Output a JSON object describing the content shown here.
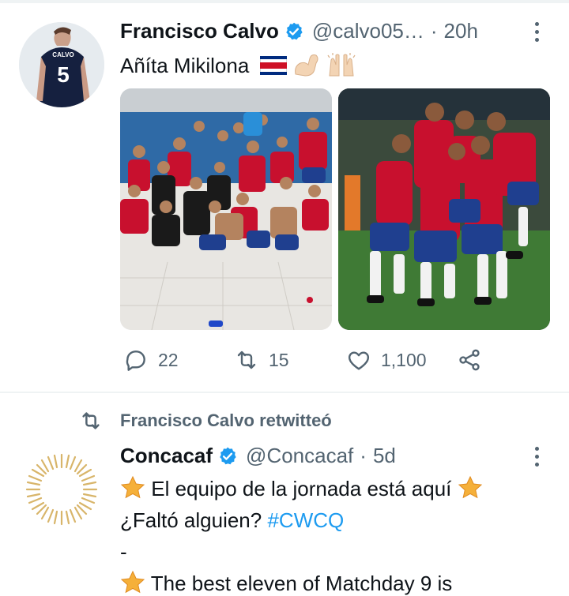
{
  "tweet1": {
    "author_name": "Francisco Calvo",
    "handle": "@calvo05…",
    "separator": "·",
    "time": "20h",
    "text": "Añíta Mikilona",
    "avatar_jersey_name": "CALVO",
    "avatar_jersey_number": "5",
    "actions": {
      "reply_count": "22",
      "retweet_count": "15",
      "like_count": "1,100"
    }
  },
  "retweet_banner": {
    "label": "Francisco Calvo retwitteó"
  },
  "tweet2": {
    "author_name": "Concacaf",
    "handle": "@Concacaf",
    "separator": "·",
    "time": "5d",
    "line1": "El equipo de la jornada está aquí",
    "line2_text": "¿Faltó alguien?",
    "line2_hashtag": "#CWCQ",
    "line3": "-",
    "line4": "The best eleven of Matchday 9 is"
  },
  "colors": {
    "text_primary": "#0f1419",
    "text_secondary": "#536471",
    "link": "#1d9bf0",
    "verified": "#1d9bf0",
    "divider": "#eff3f4"
  },
  "icons": [
    "verified-badge-icon",
    "more-options-icon",
    "reply-icon",
    "retweet-icon",
    "like-icon",
    "share-icon",
    "star-emoji-icon",
    "costa-rica-flag-icon",
    "flexed-biceps-emoji-icon",
    "raising-hands-emoji-icon"
  ]
}
